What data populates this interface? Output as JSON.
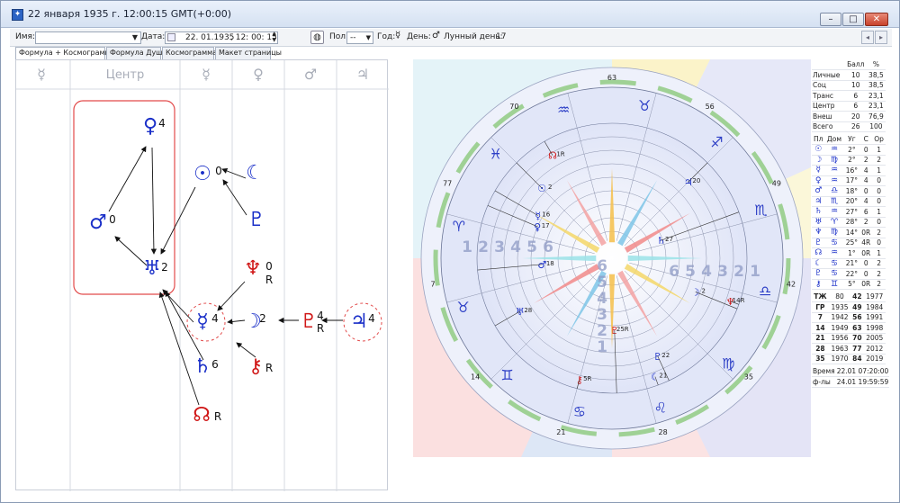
{
  "window": {
    "title": "22 января 1935 г. 12:00:15 GMT(+0:00)"
  },
  "toolbar": {
    "name_label": "Имя:",
    "name_value": "",
    "date_label": "Дата:",
    "date_value": "22. 01.1935",
    "time_value": ", 12: 00: 15",
    "sex_label": "Пол:",
    "sex_value": "--",
    "year_label": "Год:",
    "year_value": "☿",
    "day_label": "День:",
    "day_value": "♂",
    "lunar_label": "Лунный день:",
    "lunar_value": "17"
  },
  "tabs": [
    "Формула + Космограмма",
    "Формула Души",
    "Космограмма",
    "Макет страницы"
  ],
  "formula": {
    "headers": [
      {
        "glyph": "☿",
        "name": "mercury"
      },
      {
        "glyph": "Центр",
        "name": "center"
      },
      {
        "glyph": "☿",
        "name": "mercury-2"
      },
      {
        "glyph": "♀",
        "name": "venus"
      },
      {
        "glyph": "♂",
        "name": "mars"
      },
      {
        "glyph": "♃",
        "name": "jupiter"
      }
    ],
    "nodes": [
      {
        "name": "venus",
        "glyph": "♀",
        "sup": "4",
        "sub": "",
        "color": "#1a2fc8"
      },
      {
        "name": "mars",
        "glyph": "♂",
        "sup": "0",
        "sub": "",
        "color": "#1a2fc8"
      },
      {
        "name": "uranus",
        "glyph": "♅",
        "sup": "2",
        "sub": "",
        "color": "#1a2fc8"
      },
      {
        "name": "sun",
        "glyph": "☉",
        "sup": "0",
        "sub": "",
        "color": "#1a2fc8"
      },
      {
        "name": "moon-dark",
        "glyph": "☾",
        "sup": "",
        "sub": "",
        "color": "#1a2fc8"
      },
      {
        "name": "pluto",
        "glyph": "♇",
        "sup": "",
        "sub": "",
        "color": "#1a2fc8"
      },
      {
        "name": "neptune",
        "glyph": "♆",
        "sup": "0",
        "sub": "R",
        "color": "#d01818"
      },
      {
        "name": "mercury",
        "glyph": "☿",
        "sup": "4",
        "sub": "",
        "color": "#1a2fc8"
      },
      {
        "name": "moon",
        "glyph": "☽",
        "sup": "2",
        "sub": "",
        "color": "#1a2fc8"
      },
      {
        "name": "proserpina",
        "glyph": "♇",
        "sup": "4",
        "sub": "R",
        "color": "#d01818"
      },
      {
        "name": "jupiter",
        "glyph": "♃",
        "sup": "4",
        "sub": "",
        "color": "#1a2fc8"
      },
      {
        "name": "saturn",
        "glyph": "♄",
        "sup": "6",
        "sub": "",
        "color": "#1a2fc8"
      },
      {
        "name": "chiron",
        "glyph": "⚷",
        "sup": "",
        "sub": "R",
        "color": "#d01818"
      },
      {
        "name": "north-node",
        "glyph": "☊",
        "sup": "",
        "sub": "R",
        "color": "#d01818"
      }
    ]
  },
  "chart": {
    "degree_labels": [
      "63",
      "56",
      "49",
      "42",
      "35",
      "28",
      "21",
      "14",
      "7",
      "77",
      "70"
    ],
    "inner_numbers": [
      "1",
      "2",
      "3",
      "4",
      "5",
      "6"
    ],
    "planets": [
      {
        "name": "sun",
        "glyph": "☉",
        "label": "2",
        "color": "#1a2fc8"
      },
      {
        "name": "north-node",
        "glyph": "☊",
        "label": "1R",
        "color": "#d01818"
      },
      {
        "name": "mercury",
        "glyph": "☿",
        "label": "16",
        "color": "#1a2fc8"
      },
      {
        "name": "venus",
        "glyph": "♀",
        "label": "17",
        "color": "#1a2fc8"
      },
      {
        "name": "jupiter",
        "glyph": "♃",
        "label": "20",
        "color": "#1a2fc8"
      },
      {
        "name": "saturn",
        "glyph": "♄",
        "label": "27",
        "color": "#1a2fc8"
      },
      {
        "name": "mars",
        "glyph": "♂",
        "label": "18",
        "color": "#1a2fc8"
      },
      {
        "name": "neptune",
        "glyph": "♆",
        "label": "14R",
        "color": "#d01818"
      },
      {
        "name": "uranus",
        "glyph": "♅",
        "label": "28",
        "color": "#1a2fc8"
      },
      {
        "name": "moon",
        "glyph": "☽",
        "label": "2",
        "color": "#1a2fc8"
      },
      {
        "name": "proserpina",
        "glyph": "♇",
        "label": "25R",
        "color": "#d01818"
      },
      {
        "name": "pluto",
        "glyph": "♇",
        "label": "22",
        "color": "#1a2fc8"
      },
      {
        "name": "moon-dark",
        "glyph": "☾",
        "label": "21",
        "color": "#1a2fc8"
      },
      {
        "name": "chiron",
        "glyph": "⚷",
        "label": "5R",
        "color": "#d01818"
      }
    ],
    "signs": [
      {
        "name": "taurus",
        "glyph": "♉",
        "color": "#2d3fc6"
      },
      {
        "name": "sagittarius",
        "glyph": "♐",
        "color": "#2d3fc6"
      },
      {
        "name": "scorpio",
        "glyph": "♏",
        "color": "#2d3fc6"
      },
      {
        "name": "libra",
        "glyph": "♎",
        "color": "#2d3fc6"
      },
      {
        "name": "virgo",
        "glyph": "♍",
        "color": "#2d3fc6"
      },
      {
        "name": "leo",
        "glyph": "♌",
        "color": "#2d3fc6"
      },
      {
        "name": "cancer",
        "glyph": "♋",
        "color": "#2d3fc6"
      },
      {
        "name": "gemini",
        "glyph": "♊",
        "color": "#2d3fc6"
      },
      {
        "name": "taurus-2",
        "glyph": "♉",
        "color": "#2d3fc6"
      },
      {
        "name": "aries",
        "glyph": "♈",
        "color": "#2d3fc6"
      },
      {
        "name": "pisces",
        "glyph": "♓",
        "color": "#2d3fc6"
      },
      {
        "name": "aquarius",
        "glyph": "♒",
        "color": "#2d3fc6"
      }
    ]
  },
  "stats": {
    "score_header": [
      "",
      "Балл",
      "%"
    ],
    "score_rows": [
      [
        "Личные",
        "10",
        "38,5"
      ],
      [
        "Соц",
        "10",
        "38,5"
      ],
      [
        "Транс",
        "6",
        "23,1"
      ],
      [
        "Центр",
        "6",
        "23,1"
      ],
      [
        "Внеш",
        "20",
        "76,9"
      ],
      [
        "Всего",
        "26",
        "100"
      ]
    ],
    "planet_header": [
      "Пл",
      "Дом",
      "Уг",
      "С",
      "Ор"
    ],
    "planet_rows": [
      [
        "☉",
        "♒",
        "2°",
        "0",
        "1"
      ],
      [
        "☽",
        "♍",
        "2°",
        "2",
        "2"
      ],
      [
        "☿",
        "♒",
        "16°",
        "4",
        "1"
      ],
      [
        "♀",
        "♒",
        "17°",
        "4",
        "0"
      ],
      [
        "♂",
        "♎",
        "18°",
        "0",
        "0"
      ],
      [
        "♃",
        "♏",
        "20°",
        "4",
        "0"
      ],
      [
        "♄",
        "♒",
        "27°",
        "6",
        "1"
      ],
      [
        "♅",
        "♈",
        "28°",
        "2",
        "0"
      ],
      [
        "♆",
        "♍",
        "14°",
        "0R",
        "2"
      ],
      [
        "♇",
        "♋",
        "25°",
        "4R",
        "0"
      ],
      [
        "☊",
        "♒",
        "1°",
        "0R",
        "1"
      ],
      [
        "☾",
        "♋",
        "21°",
        "0",
        "2"
      ],
      [
        "♇",
        "♋",
        "22°",
        "0",
        "2"
      ],
      [
        "⚷",
        "♊",
        "5°",
        "0R",
        "2"
      ]
    ],
    "year_rows": [
      [
        "ТЖ",
        "80",
        "42",
        "1977"
      ],
      [
        "ГР",
        "1935",
        "49",
        "1984"
      ],
      [
        "7",
        "1942",
        "56",
        "1991"
      ],
      [
        "14",
        "1949",
        "63",
        "1998"
      ],
      [
        "21",
        "1956",
        "70",
        "2005"
      ],
      [
        "28",
        "1963",
        "77",
        "2012"
      ],
      [
        "35",
        "1970",
        "84",
        "2019"
      ]
    ],
    "time_rows": [
      [
        "Время",
        "22.01 07:20:00"
      ],
      [
        "ф-лы",
        "24.01 19:59:59"
      ]
    ]
  }
}
